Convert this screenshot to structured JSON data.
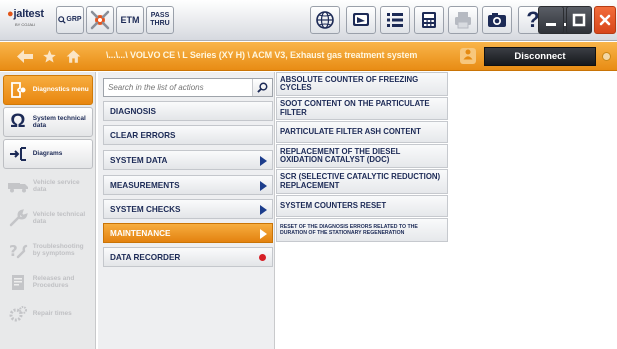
{
  "toolbar": {
    "logo_text": "jaltest",
    "logo_sub": "BY COJALI",
    "grp_label": "GRP",
    "etm_label": "ETM",
    "pass_label_1": "PASS",
    "pass_label_2": "THRU",
    "help_label": "?"
  },
  "breadcrumb": {
    "path": "\\...\\...\\ VOLVO CE \\ L Series (XY H) \\ ACM V3, Exhaust gas treatment system",
    "disconnect_label": "Disconnect"
  },
  "sidebar": {
    "items": [
      {
        "label": "Diagnostics menu",
        "state": "active",
        "icon": "diagnostics-icon"
      },
      {
        "label": "System technical data",
        "state": "normal",
        "icon": "ohm-icon"
      },
      {
        "label": "Diagrams",
        "state": "normal",
        "icon": "diagram-icon"
      },
      {
        "label": "Vehicle service data",
        "state": "disabled",
        "icon": "truck-icon"
      },
      {
        "label": "Vehicle technical data",
        "state": "disabled",
        "icon": "wrench-icon"
      },
      {
        "label": "Troubleshooting by symptoms",
        "state": "disabled",
        "icon": "tools-icon"
      },
      {
        "label": "Releases and Procedures",
        "state": "disabled",
        "icon": "document-icon"
      },
      {
        "label": "Repair times",
        "state": "disabled",
        "icon": "gears-icon"
      }
    ]
  },
  "search": {
    "placeholder": "Search in the list of actions"
  },
  "menu": {
    "items": [
      {
        "label": "DIAGNOSIS",
        "marker": "none"
      },
      {
        "label": "CLEAR ERRORS",
        "marker": "none"
      },
      {
        "label": "SYSTEM DATA",
        "marker": "arrow"
      },
      {
        "label": "MEASUREMENTS",
        "marker": "arrow"
      },
      {
        "label": "SYSTEM CHECKS",
        "marker": "arrow"
      },
      {
        "label": "MAINTENANCE",
        "marker": "arrow",
        "selected": true
      },
      {
        "label": "DATA RECORDER",
        "marker": "dot"
      }
    ]
  },
  "actions": {
    "items": [
      {
        "label": "ABSOLUTE COUNTER OF FREEZING CYCLES"
      },
      {
        "label": "SOOT CONTENT ON THE PARTICULATE FILTER"
      },
      {
        "label": "PARTICULATE FILTER ASH CONTENT"
      },
      {
        "label": "REPLACEMENT OF THE DIESEL OXIDATION CATALYST (DOC)"
      },
      {
        "label": "SCR (SELECTIVE CATALYTIC REDUCTION) REPLACEMENT"
      },
      {
        "label": "SYSTEM COUNTERS RESET"
      },
      {
        "label": "RESET OF THE DIAGNOSIS ERRORS RELATED TO THE DURATION OF THE STATIONARY REGENERATION"
      }
    ]
  },
  "colors": {
    "accent_orange": "#e8860f",
    "navy_text": "#1c2a56",
    "close_red": "#d8461a"
  }
}
